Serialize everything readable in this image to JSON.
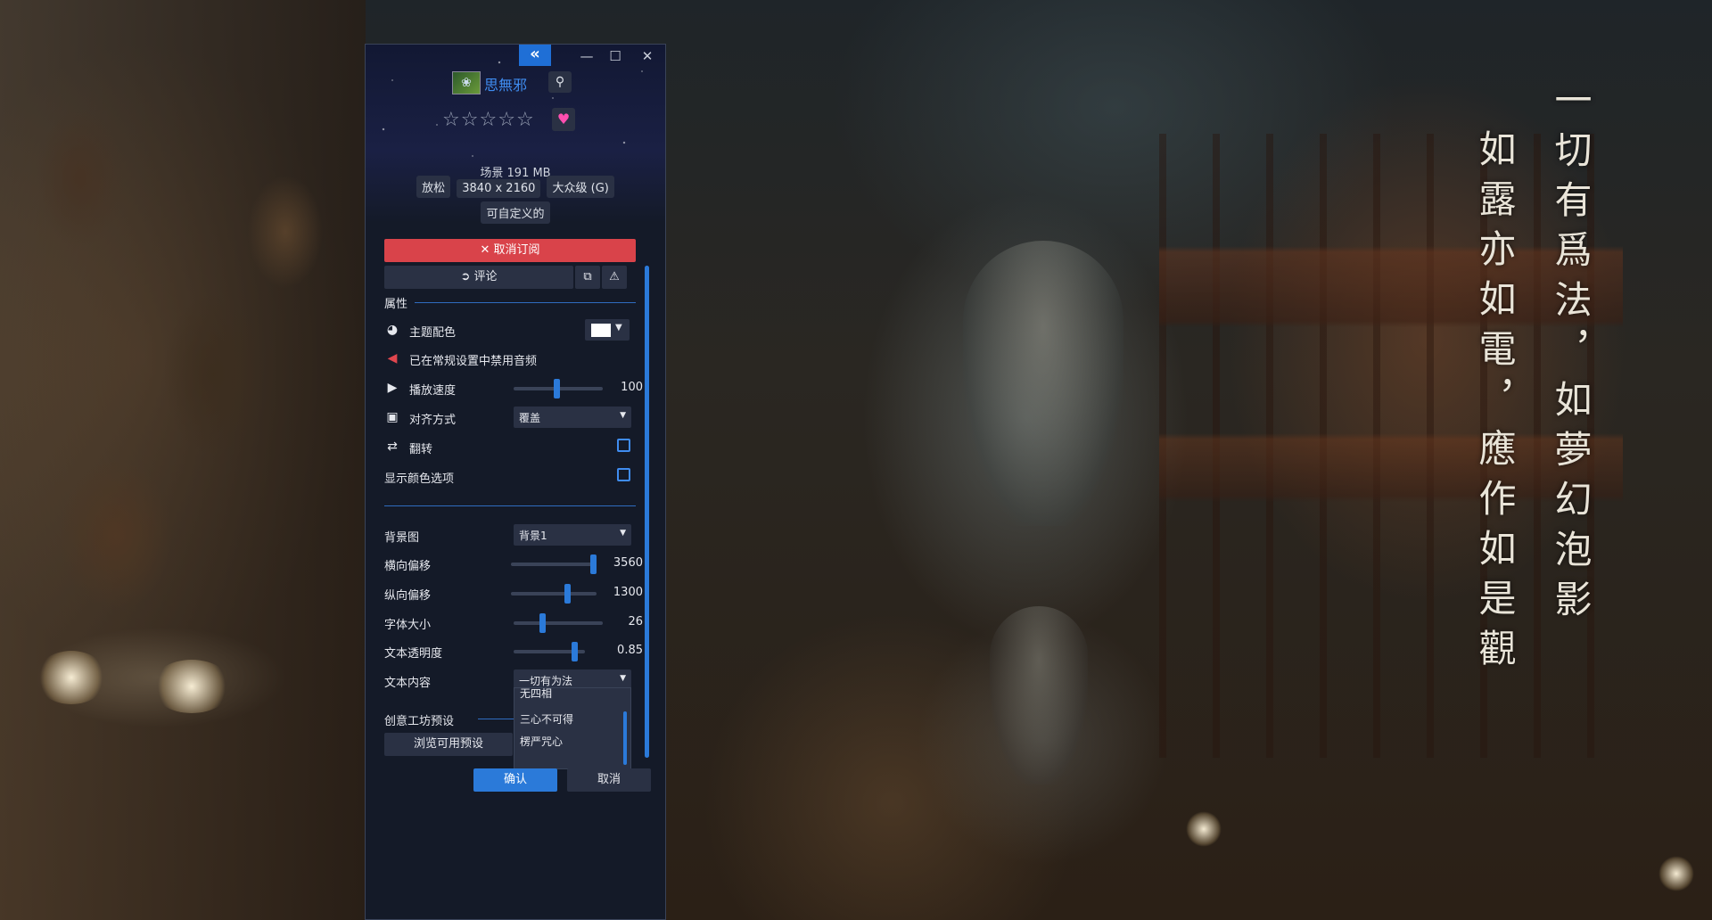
{
  "app": {
    "title": "思無邪",
    "rating_stars": 0,
    "rating_max": 5,
    "meta": "场景 191 MB",
    "tags": [
      "放松",
      "3840 x 2160",
      "大众级 (G)"
    ],
    "tag_customizable": "可自定义的"
  },
  "actions": {
    "unsubscribe": "✕ 取消订阅",
    "comment": "评论"
  },
  "properties": {
    "section_title": "属性",
    "theme_color_label": "主题配色",
    "theme_color": "#ffffff",
    "audio_disabled_label": "已在常规设置中禁用音频",
    "playback_speed_label": "播放速度",
    "playback_speed_value": "100",
    "playback_speed_fraction": 0.48,
    "align_label": "对齐方式",
    "align_value": "覆盖",
    "flip_label": "翻转",
    "flip_checked": false,
    "show_color_label": "显示颜色选项",
    "show_color_checked": false,
    "background_label": "背景图",
    "background_value": "背景1",
    "h_offset_label": "横向偏移",
    "h_offset_value": "3560",
    "h_offset_fraction": 0.96,
    "v_offset_label": "纵向偏移",
    "v_offset_value": "1300",
    "v_offset_fraction": 0.66,
    "font_size_label": "字体大小",
    "font_size_value": "26",
    "font_size_fraction": 0.32,
    "text_opacity_label": "文本透明度",
    "text_opacity_value": "0.85",
    "text_opacity_fraction": 0.85,
    "text_content_label": "文本内容",
    "text_content_value": "一切有为法",
    "text_content_options": [
      "无四相",
      "三心不可得",
      "楞严咒心"
    ],
    "workshop_preset_label": "创意工坊预设",
    "browse_presets": "浏览可用预设"
  },
  "footer": {
    "confirm": "确认",
    "cancel": "取消"
  },
  "wallpaper_text": {
    "column1": "一切有爲法，如夢幻泡影",
    "column2": "如露亦如電，應作如是觀"
  },
  "colors": {
    "accent": "#2b7ad9",
    "danger": "#d9434a",
    "panel": "#141a28",
    "control": "#2a3144"
  },
  "icons": [
    "collapse-icon",
    "minimize-icon",
    "maximize-icon",
    "close-icon",
    "search-icon",
    "heart-icon",
    "steam-icon",
    "copy-icon",
    "warning-icon",
    "palette-icon",
    "speaker-muted-icon",
    "play-icon",
    "image-icon",
    "swap-icon"
  ]
}
